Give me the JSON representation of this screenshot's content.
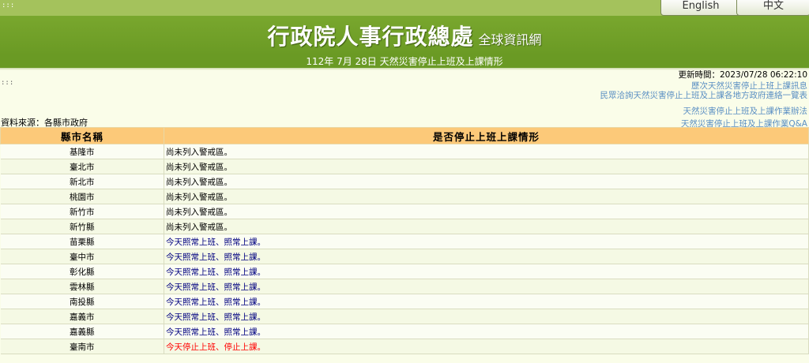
{
  "header": {
    "access_key_top": ":::",
    "lang_english": "English",
    "lang_chinese": "中文",
    "title_main": "行政院人事行政總處",
    "title_sub": "全球資訊網",
    "date_title": "112年 7月 28日 天然災害停止上班及上課情形"
  },
  "info": {
    "update_time": "更新時間：2023/07/28 06:22:10",
    "access_key_mid": ":::",
    "source": "資料來源：各縣市政府"
  },
  "links": [
    "歷次天然災害停止上班上課訊息",
    "民眾洽詢天然災害停止上班及上課各地方政府連絡一覽表",
    "天然災害停止上班及上課作業辦法",
    "天然災害停止上班及上課作業Q&A"
  ],
  "colors": {
    "banner_green": "#6a9a24",
    "header_orange": "#fcc979",
    "status_blue": "#000080",
    "status_red": "#ff0000",
    "link_blue": "#5b8fc3"
  },
  "table": {
    "headers": [
      "縣市名稱",
      "是否停止上班上課情形"
    ],
    "rows": [
      {
        "city": "基隆市",
        "status": "尚未列入警戒區。",
        "tone": "gray"
      },
      {
        "city": "臺北市",
        "status": "尚未列入警戒區。",
        "tone": "gray"
      },
      {
        "city": "新北市",
        "status": "尚未列入警戒區。",
        "tone": "gray"
      },
      {
        "city": "桃園市",
        "status": "尚未列入警戒區。",
        "tone": "gray"
      },
      {
        "city": "新竹市",
        "status": "尚未列入警戒區。",
        "tone": "gray"
      },
      {
        "city": "新竹縣",
        "status": "尚未列入警戒區。",
        "tone": "gray"
      },
      {
        "city": "苗栗縣",
        "status": "今天照常上班、照常上課。",
        "tone": "blue"
      },
      {
        "city": "臺中市",
        "status": "今天照常上班、照常上課。",
        "tone": "blue"
      },
      {
        "city": "彰化縣",
        "status": "今天照常上班、照常上課。",
        "tone": "blue"
      },
      {
        "city": "雲林縣",
        "status": "今天照常上班、照常上課。",
        "tone": "blue"
      },
      {
        "city": "南投縣",
        "status": "今天照常上班、照常上課。",
        "tone": "blue"
      },
      {
        "city": "嘉義市",
        "status": "今天照常上班、照常上課。",
        "tone": "blue"
      },
      {
        "city": "嘉義縣",
        "status": "今天照常上班、照常上課。",
        "tone": "blue"
      },
      {
        "city": "臺南市",
        "status": "今天停止上班、停止上課。",
        "tone": "red"
      }
    ]
  }
}
